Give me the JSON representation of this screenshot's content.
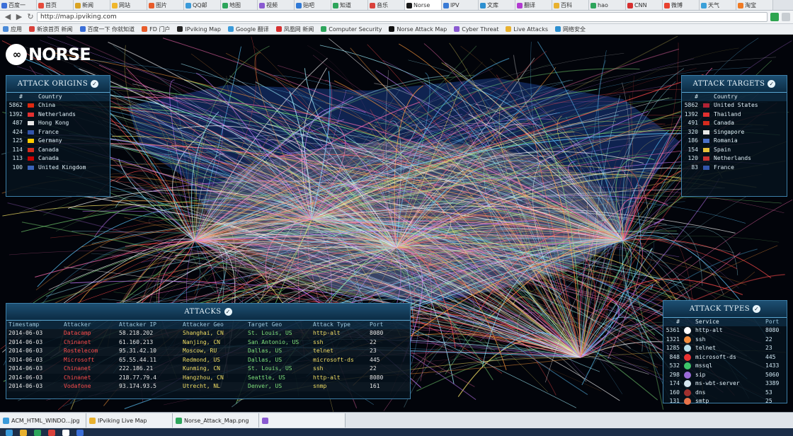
{
  "browser": {
    "tabs": [
      {
        "label": "百度一",
        "color": "#3b6fd8"
      },
      {
        "label": "首页",
        "color": "#e64a3b"
      },
      {
        "label": "新闻",
        "color": "#d9a323"
      },
      {
        "label": "网站",
        "color": "#f0b62c"
      },
      {
        "label": "图片",
        "color": "#e85c2b"
      },
      {
        "label": "QQ邮",
        "color": "#3a9ad9"
      },
      {
        "label": "地图",
        "color": "#2da55b"
      },
      {
        "label": "视频",
        "color": "#8a5ad1"
      },
      {
        "label": "贴吧",
        "color": "#2f79d6"
      },
      {
        "label": "知道",
        "color": "#2da55b"
      },
      {
        "label": "音乐",
        "color": "#d9413b"
      },
      {
        "label": "Norse",
        "color": "#1a1a1a"
      },
      {
        "label": "IPV",
        "color": "#3a7bd5"
      },
      {
        "label": "文库",
        "color": "#2c8fd0"
      },
      {
        "label": "翻译",
        "color": "#b23ad1"
      },
      {
        "label": "百科",
        "color": "#e8b12f"
      },
      {
        "label": "hao",
        "color": "#2da55b"
      },
      {
        "label": "CNN",
        "color": "#d62f2f"
      },
      {
        "label": "微博",
        "color": "#e8412f"
      },
      {
        "label": "天气",
        "color": "#3ba0d9"
      },
      {
        "label": "淘宝",
        "color": "#f07a23"
      }
    ],
    "url": "http://map.ipviking.com",
    "bookmarks": [
      {
        "label": "应用",
        "color": "#4a8ad8"
      },
      {
        "label": "新浪首页 新闻",
        "color": "#d9413b"
      },
      {
        "label": "百度一下 你就知道",
        "color": "#3b6fd8"
      },
      {
        "label": "FD 门户",
        "color": "#e85c2b"
      },
      {
        "label": "IPviking Map",
        "color": "#222"
      },
      {
        "label": "Google 翻译",
        "color": "#3a9ad9"
      },
      {
        "label": "凤凰网 新闻",
        "color": "#d62f2f"
      },
      {
        "label": "Computer Security",
        "color": "#2da55b"
      },
      {
        "label": "Norse Attack Map",
        "color": "#111"
      },
      {
        "label": "Cyber Threat",
        "color": "#8a5ad1"
      },
      {
        "label": "Live Attacks",
        "color": "#e8b12f"
      },
      {
        "label": "网络安全",
        "color": "#2c8fd0"
      }
    ]
  },
  "brand": {
    "logo": "∞",
    "name": "NORSE"
  },
  "origins": {
    "title": "ATTACK ORIGINS",
    "col_num": "#",
    "col_country": "Country",
    "rows": [
      {
        "num": "5862",
        "flag": "#de2910",
        "name": "China"
      },
      {
        "num": "1392",
        "flag": "#e33030",
        "name": "Netherlands"
      },
      {
        "num": "487",
        "flag": "#e8e8e8",
        "name": "Hong Kong"
      },
      {
        "num": "424",
        "flag": "#3355aa",
        "name": "France"
      },
      {
        "num": "125",
        "flag": "#ffcc00",
        "name": "Germany"
      },
      {
        "num": "114",
        "flag": "#d52b1e",
        "name": "Canada"
      },
      {
        "num": "113",
        "flag": "#cc0000",
        "name": "Canada"
      },
      {
        "num": "100",
        "flag": "#3a62b8",
        "name": "United Kingdom"
      }
    ]
  },
  "targets": {
    "title": "ATTACK TARGETS",
    "col_num": "#",
    "col_country": "Country",
    "rows": [
      {
        "num": "5862",
        "flag": "#b22234",
        "name": "United States"
      },
      {
        "num": "1392",
        "flag": "#e23030",
        "name": "Thailand"
      },
      {
        "num": "491",
        "flag": "#d52b1e",
        "name": "Canada"
      },
      {
        "num": "320",
        "flag": "#e8e8e8",
        "name": "Singapore"
      },
      {
        "num": "186",
        "flag": "#4a70c8",
        "name": "Romania"
      },
      {
        "num": "154",
        "flag": "#e8c23a",
        "name": "Spain"
      },
      {
        "num": "120",
        "flag": "#cc3333",
        "name": "Netherlands"
      },
      {
        "num": "83",
        "flag": "#3355aa",
        "name": "France"
      }
    ]
  },
  "attacks": {
    "title": "ATTACKS",
    "headers": [
      "Timestamp",
      "Attacker",
      "Attacker IP",
      "Attacker Geo",
      "Target Geo",
      "Attack Type",
      "Port"
    ],
    "rows": [
      [
        "2014-06-03",
        "Datacamp",
        "58.218.202",
        "Shanghai, CN",
        "St. Louis, US",
        "http-alt",
        "8080"
      ],
      [
        "2014-06-03",
        "Chinanet",
        "61.160.213",
        "Nanjing, CN",
        "San Antonio, US",
        "ssh",
        "22"
      ],
      [
        "2014-06-03",
        "Rostelecom",
        "95.31.42.10",
        "Moscow, RU",
        "Dallas, US",
        "telnet",
        "23"
      ],
      [
        "2014-06-03",
        "Microsoft",
        "65.55.44.11",
        "Redmond, US",
        "Dallas, US",
        "microsoft-ds",
        "445"
      ],
      [
        "2014-06-03",
        "Chinanet",
        "222.186.21",
        "Kunming, CN",
        "St. Louis, US",
        "ssh",
        "22"
      ],
      [
        "2014-06-03",
        "Chinanet",
        "218.77.79.4",
        "Hangzhou, CN",
        "Seattle, US",
        "http-alt",
        "8080"
      ],
      [
        "2014-06-03",
        "Vodafone",
        "93.174.93.5",
        "Utrecht, NL",
        "Denver, US",
        "snmp",
        "161"
      ]
    ]
  },
  "types": {
    "title": "ATTACK TYPES",
    "col_num": "#",
    "col_service": "Service",
    "col_port": "Port",
    "rows": [
      {
        "num": "5361",
        "color": "#ffffff",
        "service": "http-alt",
        "port": "8080"
      },
      {
        "num": "1321",
        "color": "#f08a3c",
        "service": "ssh",
        "port": "22"
      },
      {
        "num": "1285",
        "color": "#b9e0ec",
        "service": "telnet",
        "port": "23"
      },
      {
        "num": "848",
        "color": "#e63232",
        "service": "microsoft-ds",
        "port": "445"
      },
      {
        "num": "532",
        "color": "#3ec46a",
        "service": "mssql",
        "port": "1433"
      },
      {
        "num": "298",
        "color": "#9a6ad8",
        "service": "sip",
        "port": "5060"
      },
      {
        "num": "174",
        "color": "#d6e6f0",
        "service": "ms-wbt-server",
        "port": "3389"
      },
      {
        "num": "160",
        "color": "#a0302e",
        "service": "dns",
        "port": "53"
      },
      {
        "num": "131",
        "color": "#e8734a",
        "service": "smtp",
        "port": "25"
      }
    ]
  },
  "taskbar": {
    "tasks": [
      {
        "label": "ACM_HTML_WINDO...jpg",
        "color": "#3a9ad9"
      },
      {
        "label": "IPviking Live Map",
        "color": "#e8b12f"
      },
      {
        "label": "Norse_Attack_Map.png",
        "color": "#2da55b"
      },
      {
        "label": "",
        "color": "#8a5ad1"
      }
    ],
    "icons": [
      "#3a9ad9",
      "#e8b12f",
      "#2da55b",
      "#d9413b",
      "#ffffff",
      "#3b6fd8"
    ]
  }
}
